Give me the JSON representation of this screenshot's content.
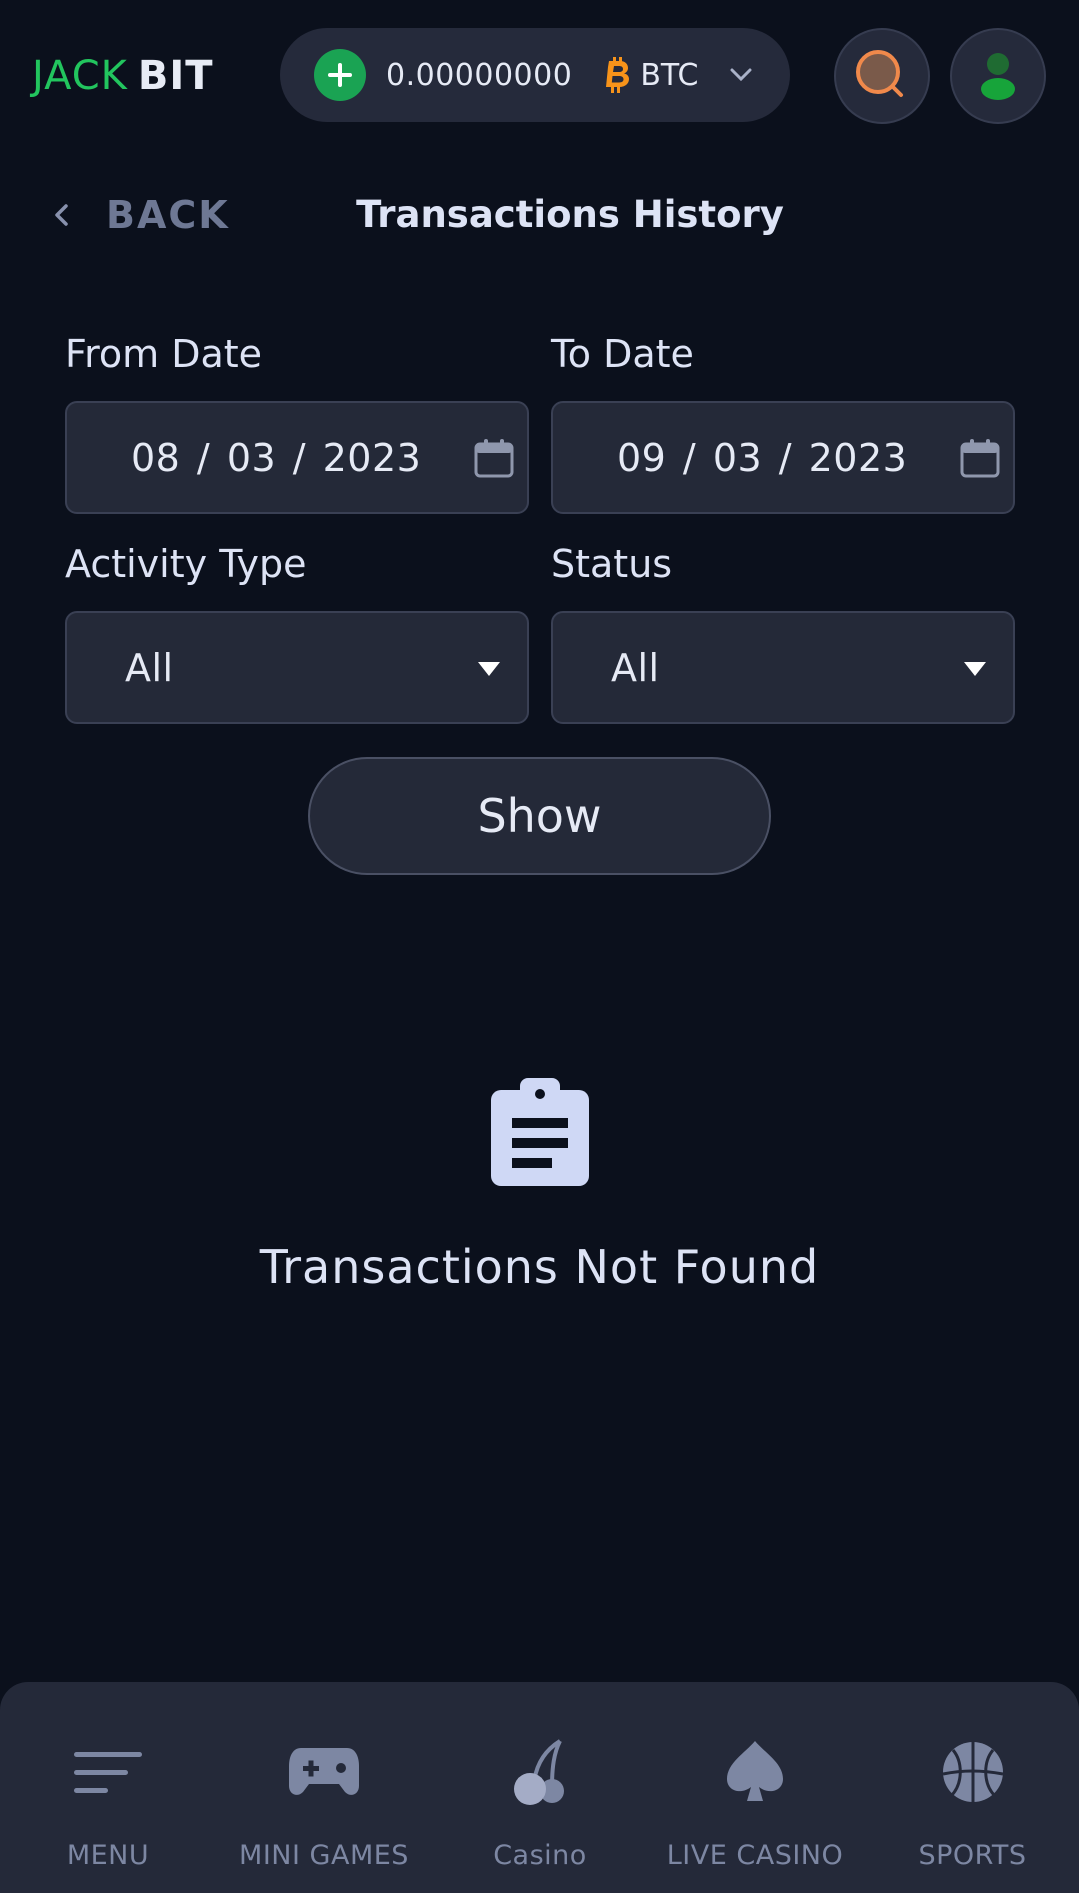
{
  "header": {
    "logo_left": "JACK",
    "logo_right": "BIT",
    "balance": "0.00000000",
    "currency": "BTC",
    "plus_icon": "plus-icon",
    "search_icon": "search-icon",
    "profile_icon": "user-icon"
  },
  "nav": {
    "back_label": "BACK",
    "title": "Transactions History"
  },
  "filters": {
    "from_label": "From Date",
    "from_value": "08 / 03 / 2023",
    "to_label": "To Date",
    "to_value": "09 / 03 / 2023",
    "activity_label": "Activity Type",
    "activity_value": "All",
    "status_label": "Status",
    "status_value": "All",
    "show_label": "Show"
  },
  "empty_state": {
    "icon": "clipboard-icon",
    "message": "Transactions Not Found"
  },
  "bottom_nav": {
    "items": [
      {
        "label": "MENU",
        "icon": "menu-icon"
      },
      {
        "label": "MINI GAMES",
        "icon": "gamepad-icon"
      },
      {
        "label": "Casino",
        "icon": "cherry-icon"
      },
      {
        "label": "LIVE CASINO",
        "icon": "spade-icon"
      },
      {
        "label": "SPORTS",
        "icon": "basketball-icon"
      }
    ]
  },
  "colors": {
    "background": "#0b101c",
    "surface": "#242938",
    "brand_green": "#22c55e",
    "btc_orange": "#f7931a"
  }
}
